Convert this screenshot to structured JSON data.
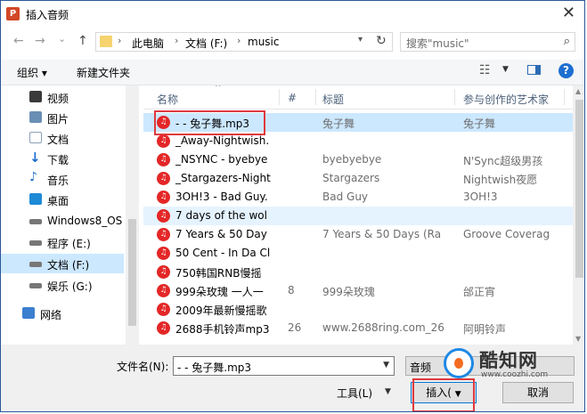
{
  "window": {
    "title": "插入音频",
    "app_badge": "P"
  },
  "nav": {
    "back": "←",
    "forward": "→",
    "recent": "⌄",
    "up": "↑",
    "breadcrumb": [
      "此电脑",
      "文档 (F:)",
      "music"
    ],
    "search_placeholder": "搜索\"music\""
  },
  "toolbar": {
    "organize": "组织 ▾",
    "new_folder": "新建文件夹",
    "help": "?"
  },
  "sidebar": {
    "items": [
      {
        "label": "视频",
        "icon": "video-icon",
        "color": "#3a3a3a"
      },
      {
        "label": "图片",
        "icon": "pictures-icon",
        "color": "#6a8fb5"
      },
      {
        "label": "文档",
        "icon": "documents-icon",
        "color": "#8aa0b8"
      },
      {
        "label": "下载",
        "icon": "download-icon",
        "color": "#1e6fd0"
      },
      {
        "label": "音乐",
        "icon": "music-icon",
        "color": "#1e6fd0"
      },
      {
        "label": "桌面",
        "icon": "desktop-icon",
        "color": "#1e8ad6"
      },
      {
        "label": "Windows8_OS",
        "icon": "drive-icon",
        "color": "#777777"
      },
      {
        "label": "程序 (E:)",
        "icon": "drive-icon",
        "color": "#777777"
      },
      {
        "label": "文档 (F:)",
        "icon": "drive-icon",
        "color": "#777777"
      },
      {
        "label": "娱乐 (G:)",
        "icon": "drive-icon",
        "color": "#777777"
      },
      {
        "label": "网络",
        "icon": "network-icon",
        "color": "#3b7fcf"
      }
    ]
  },
  "columns": {
    "name": "名称",
    "num": "#",
    "title": "标题",
    "artist": "参与创作的艺术家"
  },
  "files": [
    {
      "name": "- - 兔子舞.mp3",
      "num": "",
      "title": "兔子舞",
      "artist": "兔子舞"
    },
    {
      "name": "_Away-Nightwish.",
      "num": "",
      "title": "",
      "artist": ""
    },
    {
      "name": "_NSYNC - byebye",
      "num": "",
      "title": "byebyebye",
      "artist": "N'Sync超级男孩"
    },
    {
      "name": "_Stargazers-Night",
      "num": "",
      "title": "Stargazers",
      "artist": "Nightwish夜愿"
    },
    {
      "name": "3OH!3 - Bad Guy.",
      "num": "",
      "title": "Bad Guy",
      "artist": "3OH!3"
    },
    {
      "name": "7 days of the wol",
      "num": "",
      "title": "",
      "artist": ""
    },
    {
      "name": "7 Years & 50 Day",
      "num": "",
      "title": "7 Years & 50 Days (Ra",
      "artist": "Groove Coverag"
    },
    {
      "name": "50 Cent - In Da Cl",
      "num": "",
      "title": "",
      "artist": ""
    },
    {
      "name": "750韩国RNB慢摇",
      "num": "",
      "title": "",
      "artist": ""
    },
    {
      "name": "999朵玫瑰 一人一",
      "num": "8",
      "title": "999朵玫瑰",
      "artist": "邰正宵"
    },
    {
      "name": "2009年最新慢摇歌",
      "num": "",
      "title": "",
      "artist": ""
    },
    {
      "name": "2688手机铃声mp3",
      "num": "26",
      "title": "www.2688ring.com_26",
      "artist": "阿明铃声"
    }
  ],
  "bottom": {
    "filename_label": "文件名(N):",
    "filename_value": "- - 兔子舞.mp3",
    "filetype_value": "音频",
    "tools": "工具(L)",
    "insert": "插入(",
    "cancel": "取消"
  },
  "watermark": {
    "name": "酷知网",
    "url": "www.coozhi.com"
  }
}
